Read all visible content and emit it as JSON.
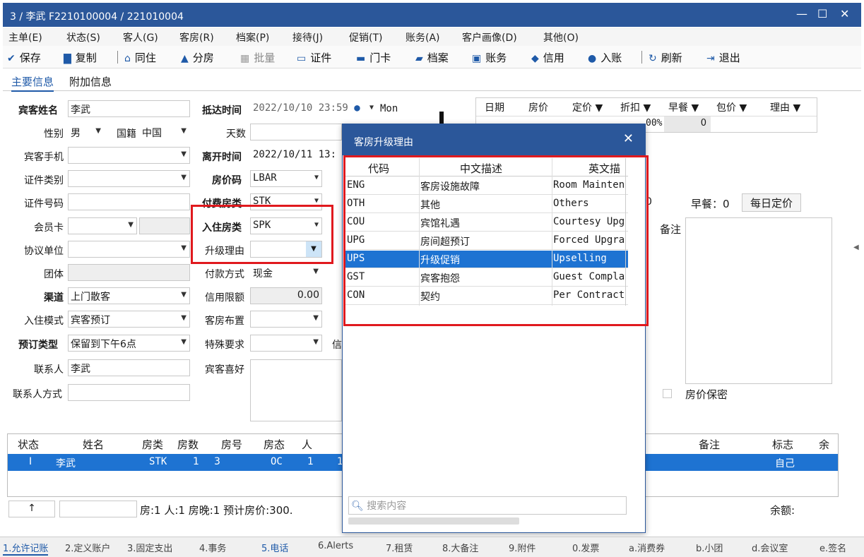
{
  "window": {
    "title": "3 / 李武  F2210100004 / 221010004"
  },
  "menu": [
    "主单(E)",
    "状态(S)",
    "客人(G)",
    "客房(R)",
    "档案(P)",
    "接待(J)",
    "促销(T)",
    "账务(A)",
    "客户画像(D)",
    "其他(O)"
  ],
  "toolbar": [
    "保存",
    "复制",
    "同住",
    "分房",
    "批量",
    "证件",
    "门卡",
    "档案",
    "账务",
    "信用",
    "入账",
    "刷新",
    "退出"
  ],
  "tabs": {
    "main": "主要信息",
    "extra": "附加信息"
  },
  "form": {
    "guest_name_label": "宾客姓名",
    "guest_name": "李武",
    "gender_label": "性别",
    "gender": "男",
    "nationality_label": "国籍",
    "nationality": "中国",
    "phone_label": "宾客手机",
    "id_type_label": "证件类别",
    "id_no_label": "证件号码",
    "member_label": "会员卡",
    "agreement_label": "协议单位",
    "group_label": "团体",
    "channel_label": "渠道",
    "channel": "上门散客",
    "checkin_mode_label": "入住模式",
    "checkin_mode": "宾客预订",
    "booking_type_label": "预订类型",
    "booking_type": "保留到下午6点",
    "contact_label": "联系人",
    "contact": "李武",
    "contact_method_label": "联系人方式",
    "arrival_label": "抵达时间",
    "arrival": "2022/10/10 23:59",
    "arrival_day": "Mon",
    "nights_label": "天数",
    "departure_label": "离开时间",
    "departure": "2022/10/11 13:",
    "rate_code_label": "房价码",
    "rate_code": "LBAR",
    "pay_room_label": "付费房类",
    "pay_room": "STK",
    "stay_room_label": "入住房类",
    "stay_room": "SPK",
    "upgrade_label": "升级理由",
    "upgrade": "",
    "pay_method_label": "付款方式",
    "pay_method": "现金",
    "credit_label": "信用限额",
    "credit": "0.00",
    "layout_label": "客房布置",
    "special_label": "特殊要求",
    "special_tail": "信",
    "pref_label": "宾客喜好"
  },
  "rate_grid": {
    "headers": [
      "日期",
      "房价",
      "定价 ▼",
      "折扣 ▼",
      "早餐 ▼",
      "包价 ▼",
      "理由 ▼"
    ],
    "row_tail": "00%",
    "row_bf": "0"
  },
  "right": {
    "breakfast": "早餐：0",
    "daily_rate_btn": "每日定价",
    "remark_label": "备注",
    "secret_label": "房价保密",
    "partial": "0"
  },
  "popup": {
    "title": "客房升级理由",
    "headers": [
      "代码",
      "中文描述",
      "英文描"
    ],
    "rows": [
      {
        "code": "ENG",
        "cn": "客房设施故障",
        "en": "Room Mainten"
      },
      {
        "code": "OTH",
        "cn": "其他",
        "en": "Others"
      },
      {
        "code": "COU",
        "cn": "宾馆礼遇",
        "en": "Courtesy Upg"
      },
      {
        "code": "UPG",
        "cn": "房间超预订",
        "en": "Forced Upgra"
      },
      {
        "code": "UPS",
        "cn": "升级促销",
        "en": "Upselling"
      },
      {
        "code": "GST",
        "cn": "宾客抱怨",
        "en": "Guest Compla"
      },
      {
        "code": "CON",
        "cn": "契约",
        "en": "Per Contract"
      }
    ],
    "search_placeholder": "搜索内容"
  },
  "guest_grid": {
    "headers": [
      "状态",
      "姓名",
      "房类",
      "房数",
      "房号",
      "房态",
      "人",
      "备注",
      "标志",
      "余"
    ],
    "row": {
      "status": "I",
      "name": "李武",
      "type": "STK",
      "count": "1",
      "room": "3",
      "state": "OC",
      "persons": "1",
      "p2": "1",
      "flag": "自己"
    }
  },
  "summary": {
    "up": "↑",
    "text": "房:1  人:1  房晚:1  预计房价:300.",
    "balance": "余额:"
  },
  "statusbar": [
    "1.允许记账",
    "2.定义账户",
    "3.固定支出",
    "4.事务",
    "5.电话",
    "6.Alerts",
    "7.租赁",
    "8.大备注",
    "9.附件",
    "0.发票",
    "a.消费券",
    "b.小团",
    "d.会议室",
    "e.签名"
  ]
}
